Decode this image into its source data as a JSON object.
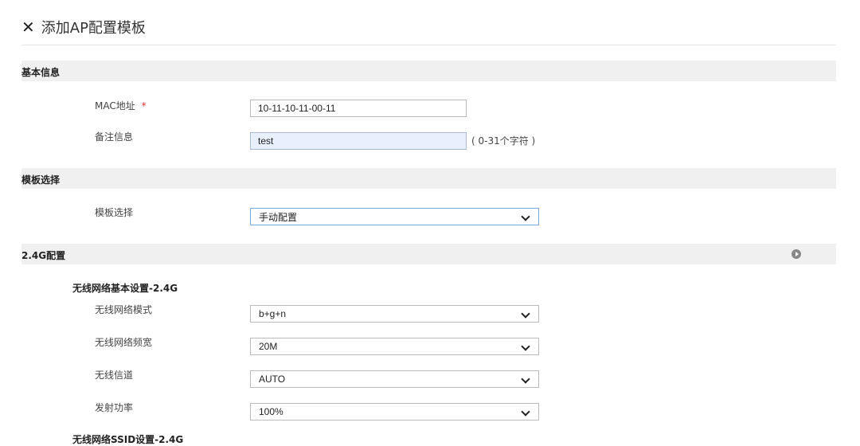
{
  "dialog": {
    "title": "添加AP配置模板",
    "close_symbol": "✕"
  },
  "basic": {
    "section_label": "基本信息",
    "mac_label": "MAC地址",
    "required_mark": "*",
    "mac_value": "10-11-10-11-00-11",
    "remark_label": "备注信息",
    "remark_value": "test",
    "remark_hint": "( 0-31个字符 )"
  },
  "template": {
    "section_label": "模板选择",
    "field_label": "模板选择",
    "selected": "手动配置"
  },
  "wifi24": {
    "section_label": "2.4G配置",
    "basic_subtitle": "无线网络基本设置-2.4G",
    "mode_label": "无线网络模式",
    "mode_value": "b+g+n",
    "bandwidth_label": "无线网络频宽",
    "bandwidth_value": "20M",
    "channel_label": "无线信道",
    "channel_value": "AUTO",
    "power_label": "发射功率",
    "power_value": "100%",
    "ssid_subtitle": "无线网络SSID设置-2.4G"
  },
  "icons": {
    "close": "close-icon",
    "expand": "expand-icon",
    "dropdown": "chevron-down-icon"
  }
}
